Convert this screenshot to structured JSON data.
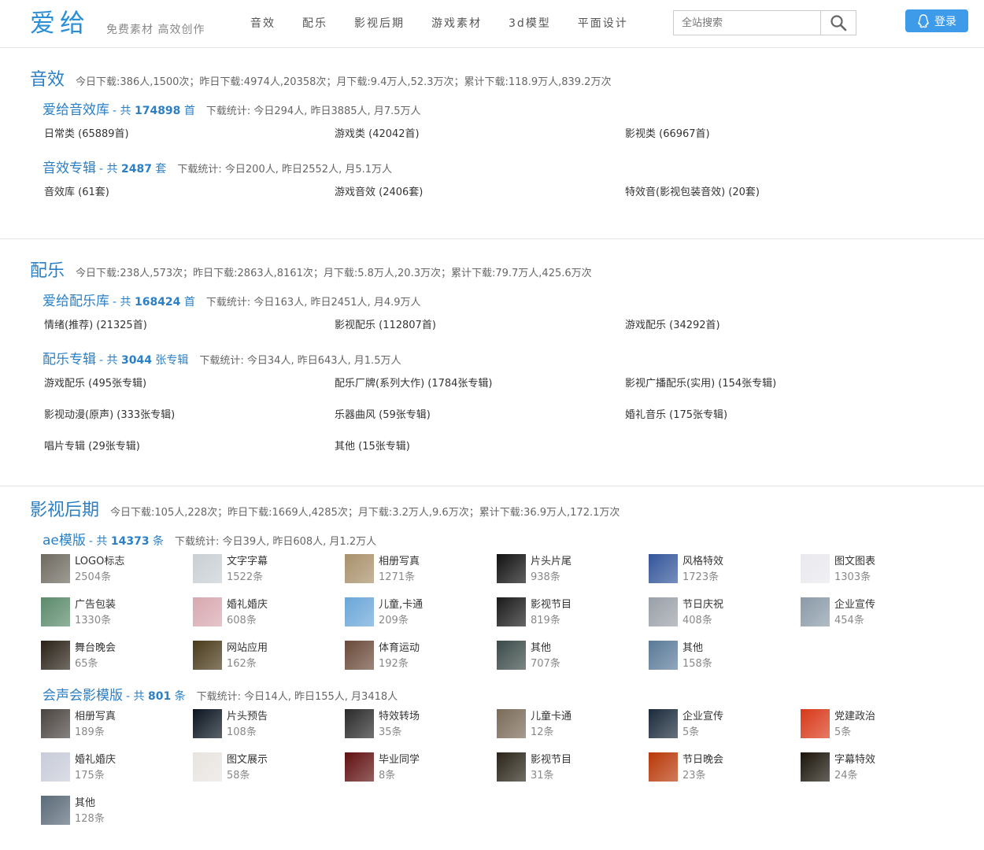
{
  "header": {
    "logo": "爱给",
    "slogan": "免费素材  高效创作",
    "nav": [
      "音效",
      "配乐",
      "影视后期",
      "游戏素材",
      "3d模型",
      "平面设计"
    ],
    "search_placeholder": "全站搜索",
    "login_label": "登录"
  },
  "sections": [
    {
      "title": "音效",
      "stats": "今日下载:386人,1500次；昨日下载:4974人,20358次；月下载:9.4万人,52.3万次；累计下载:118.9万人,839.2万次",
      "subs": [
        {
          "name": "爱给音效库",
          "count_prefix": "- 共",
          "count": "174898",
          "unit": "首",
          "stat": "下载统计: 今日294人, 昨日3885人, 月7.5万人",
          "cats": [
            "日常类 (65889首)",
            "游戏类 (42042首)",
            "影视类 (66967首)"
          ]
        },
        {
          "name": "音效专辑",
          "count_prefix": "- 共",
          "count": "2487",
          "unit": "套",
          "stat": "下载统计: 今日200人, 昨日2552人, 月5.1万人",
          "cats": [
            "音效库 (61套)",
            "游戏音效 (2406套)",
            "特效音(影视包装音效) (20套)"
          ]
        }
      ]
    },
    {
      "title": "配乐",
      "stats": "今日下载:238人,573次；昨日下载:2863人,8161次；月下载:5.8万人,20.3万次；累计下载:79.7万人,425.6万次",
      "subs": [
        {
          "name": "爱给配乐库",
          "count_prefix": "- 共",
          "count": "168424",
          "unit": "首",
          "stat": "下载统计: 今日163人, 昨日2451人, 月4.9万人",
          "cats": [
            "情绪(推荐) (21325首)",
            "影视配乐 (112807首)",
            "游戏配乐 (34292首)"
          ]
        },
        {
          "name": "配乐专辑",
          "count_prefix": "- 共",
          "count": "3044",
          "unit": "张专辑",
          "stat": "下载统计: 今日34人, 昨日643人, 月1.5万人",
          "cats": [
            "游戏配乐 (495张专辑)",
            "配乐厂牌(系列大作) (1784张专辑)",
            "影视广播配乐(实用) (154张专辑)",
            "影视动漫(原声) (333张专辑)",
            "乐器曲风 (59张专辑)",
            "婚礼音乐 (175张专辑)",
            "唱片专辑 (29张专辑)",
            "其他 (15张专辑)"
          ]
        }
      ]
    },
    {
      "title": "影视后期",
      "stats": "今日下载:105人,228次；昨日下载:1669人,4285次；月下载:3.2万人,9.6万次；累计下载:36.9万人,172.1万次",
      "subs": [
        {
          "name": "ae模版",
          "count_prefix": "- 共",
          "count": "14373",
          "unit": "条",
          "stat": "下载统计: 今日39人, 昨日608人, 月1.2万人",
          "tiles": [
            {
              "name": "LOGO标志",
              "count": "2504条",
              "color": "#6d6a60"
            },
            {
              "name": "文字字幕",
              "count": "1522条",
              "color": "#c9cfd4"
            },
            {
              "name": "相册写真",
              "count": "1271条",
              "color": "#a8906a"
            },
            {
              "name": "片头片尾",
              "count": "938条",
              "color": "#111111"
            },
            {
              "name": "风格特效",
              "count": "1723条",
              "color": "#33559a"
            },
            {
              "name": "图文图表",
              "count": "1303条",
              "color": "#e9e9ee"
            },
            {
              "name": "广告包装",
              "count": "1330条",
              "color": "#5a8a6a"
            },
            {
              "name": "婚礼婚庆",
              "count": "608条",
              "color": "#d8a8b0"
            },
            {
              "name": "儿童,卡通",
              "count": "209条",
              "color": "#6aa6d8"
            },
            {
              "name": "影视节目",
              "count": "819条",
              "color": "#1a1a1a"
            },
            {
              "name": "节日庆祝",
              "count": "408条",
              "color": "#9aa0a8"
            },
            {
              "name": "企业宣传",
              "count": "454条",
              "color": "#8a9aa8"
            },
            {
              "name": "舞台晚会",
              "count": "65条",
              "color": "#2a2218"
            },
            {
              "name": "网站应用",
              "count": "162条",
              "color": "#4a3a1a"
            },
            {
              "name": "体育运动",
              "count": "192条",
              "color": "#6a4a3a"
            },
            {
              "name": "其他",
              "count": "707条",
              "color": "#3a4a48"
            },
            {
              "name": "其他",
              "count": "158条",
              "color": "#5a7a98"
            }
          ]
        },
        {
          "name": "会声会影模版",
          "count_prefix": "- 共",
          "count": "801",
          "unit": "条",
          "stat": "下载统计: 今日14人, 昨日155人, 月3418人",
          "tiles": [
            {
              "name": "相册写真",
              "count": "189条",
              "color": "#4a4440"
            },
            {
              "name": "片头预告",
              "count": "108条",
              "color": "#0a1420"
            },
            {
              "name": "特效转场",
              "count": "35条",
              "color": "#2a2a2a"
            },
            {
              "name": "儿童卡通",
              "count": "12条",
              "color": "#7a6a58"
            },
            {
              "name": "企业宣传",
              "count": "5条",
              "color": "#1a2a3a"
            },
            {
              "name": "党建政治",
              "count": "5条",
              "color": "#d83818"
            },
            {
              "name": "婚礼婚庆",
              "count": "175条",
              "color": "#c8ccd8"
            },
            {
              "name": "图文展示",
              "count": "58条",
              "color": "#e8e4e0"
            },
            {
              "name": "毕业同学",
              "count": "8条",
              "color": "#601010"
            },
            {
              "name": "影视节目",
              "count": "31条",
              "color": "#2a2418"
            },
            {
              "name": "节日晚会",
              "count": "23条",
              "color": "#b83808"
            },
            {
              "name": "字幕特效",
              "count": "24条",
              "color": "#1a140a"
            },
            {
              "name": "其他",
              "count": "128条",
              "color": "#5a6a78"
            }
          ]
        }
      ]
    }
  ]
}
